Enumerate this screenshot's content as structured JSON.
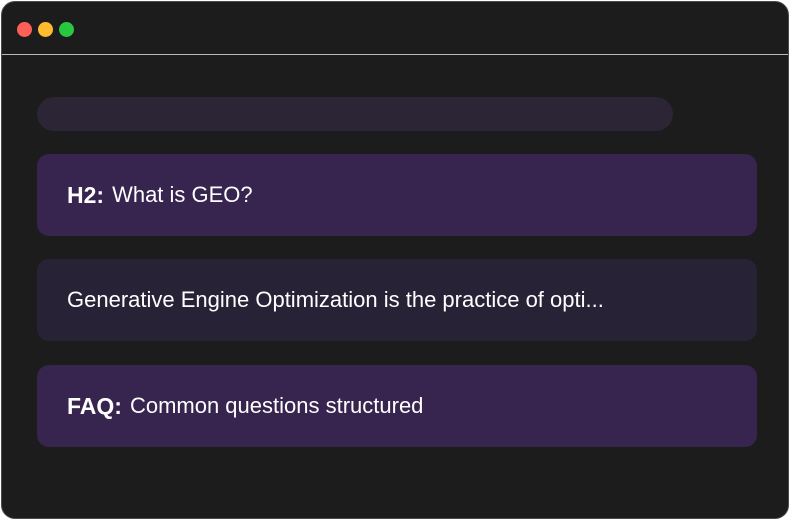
{
  "colors": {
    "window_bg": "#1c1c1c",
    "dot_red": "#fe5f57",
    "dot_yellow": "#febc2e",
    "dot_green": "#28c840",
    "skeleton": "#2b2536",
    "card_highlight": "#37244f",
    "card_plain": "#282236"
  },
  "window_controls": [
    "close",
    "minimize",
    "maximize"
  ],
  "cards": [
    {
      "label": "H2:",
      "text": "What is GEO?"
    },
    {
      "label": "",
      "text": "Generative Engine Optimization is the practice of opti..."
    },
    {
      "label": "FAQ:",
      "text": "Common questions structured"
    }
  ]
}
